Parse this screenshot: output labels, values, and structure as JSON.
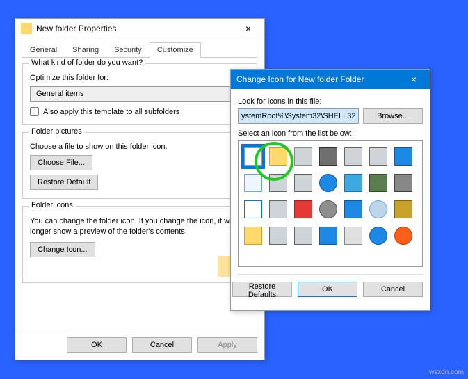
{
  "properties": {
    "title": "New folder Properties",
    "tabs": [
      "General",
      "Sharing",
      "Security",
      "Customize"
    ],
    "active_tab": 3,
    "kind_q": "What kind of folder do you want?",
    "optimize_label": "Optimize this folder for:",
    "combo_value": "General items",
    "apply_subfolders": "Also apply this template to all subfolders",
    "pictures_title": "Folder pictures",
    "pictures_desc": "Choose a file to show on this folder icon.",
    "choose_file": "Choose File...",
    "restore_default": "Restore Default",
    "icons_title": "Folder icons",
    "icons_desc": "You can change the folder icon. If you change the icon, it will no longer show a preview of the folder's contents.",
    "change_icon": "Change Icon...",
    "ok": "OK",
    "cancel": "Cancel",
    "apply": "Apply"
  },
  "picker": {
    "title": "Change Icon for New folder Folder",
    "look_label": "Look for icons in this file:",
    "path": "ystemRoot%\\System32\\SHELL32.dll",
    "browse": "Browse...",
    "select_label": "Select an icon from the list below:",
    "restore_defaults": "Restore Defaults",
    "ok": "OK",
    "cancel": "Cancel"
  },
  "icons": [
    {
      "name": "doc-icon",
      "fill": "#ffffff",
      "border": "#999"
    },
    {
      "name": "folder-icon",
      "fill": "#ffd96b",
      "border": "#c9a22c"
    },
    {
      "name": "drive-icon",
      "fill": "#cfd4d8",
      "border": "#888"
    },
    {
      "name": "ram-icon",
      "fill": "#6f6f6f",
      "border": "#333"
    },
    {
      "name": "printer-icon",
      "fill": "#cfd4d8",
      "border": "#666"
    },
    {
      "name": "floppy-icon",
      "fill": "#cfd4d8",
      "border": "#666"
    },
    {
      "name": "monitor-icon",
      "fill": "#1e88e5",
      "border": "#0b5aa8"
    },
    {
      "name": "notes-icon",
      "fill": "#eef6ff",
      "border": "#6aa5de"
    },
    {
      "name": "hdd-icon",
      "fill": "#cfd4d8",
      "border": "#666"
    },
    {
      "name": "cd-drive-icon",
      "fill": "#cfd4d8",
      "border": "#666"
    },
    {
      "name": "globe-icon",
      "fill": "#1e88e5",
      "border": "#0b5aa8"
    },
    {
      "name": "net-drive-icon",
      "fill": "#3ca9e0",
      "border": "#1a6fa3"
    },
    {
      "name": "chip-icon",
      "fill": "#5b7e4f",
      "border": "#2f4a26"
    },
    {
      "name": "dvd-icon",
      "fill": "#888",
      "border": "#444"
    },
    {
      "name": "window-icon",
      "fill": "#ffffff",
      "border": "#0078d7"
    },
    {
      "name": "printer2-icon",
      "fill": "#cfd4d8",
      "border": "#666"
    },
    {
      "name": "block-icon",
      "fill": "#e53935",
      "border": "#a81c1c"
    },
    {
      "name": "disc-icon",
      "fill": "#8e8e8e",
      "border": "#555"
    },
    {
      "name": "network-icon",
      "fill": "#1e88e5",
      "border": "#0b5aa8"
    },
    {
      "name": "search-icon",
      "fill": "#bcd5e8",
      "border": "#6aa5de"
    },
    {
      "name": "gears-icon",
      "fill": "#c9a22c",
      "border": "#7d6615"
    },
    {
      "name": "folder2-icon",
      "fill": "#ffd96b",
      "border": "#c9a22c"
    },
    {
      "name": "device-icon",
      "fill": "#cfd4d8",
      "border": "#666"
    },
    {
      "name": "drive2-icon",
      "fill": "#cfd4d8",
      "border": "#666"
    },
    {
      "name": "laptop-icon",
      "fill": "#1e88e5",
      "border": "#0b5aa8"
    },
    {
      "name": "calendar-icon",
      "fill": "#e0e0e0",
      "border": "#888"
    },
    {
      "name": "help-icon",
      "fill": "#1e88e5",
      "border": "#0b5aa8"
    },
    {
      "name": "stop-icon",
      "fill": "#fb5f1a",
      "border": "#b53f0b"
    }
  ],
  "watermark": "wsxdn.com"
}
